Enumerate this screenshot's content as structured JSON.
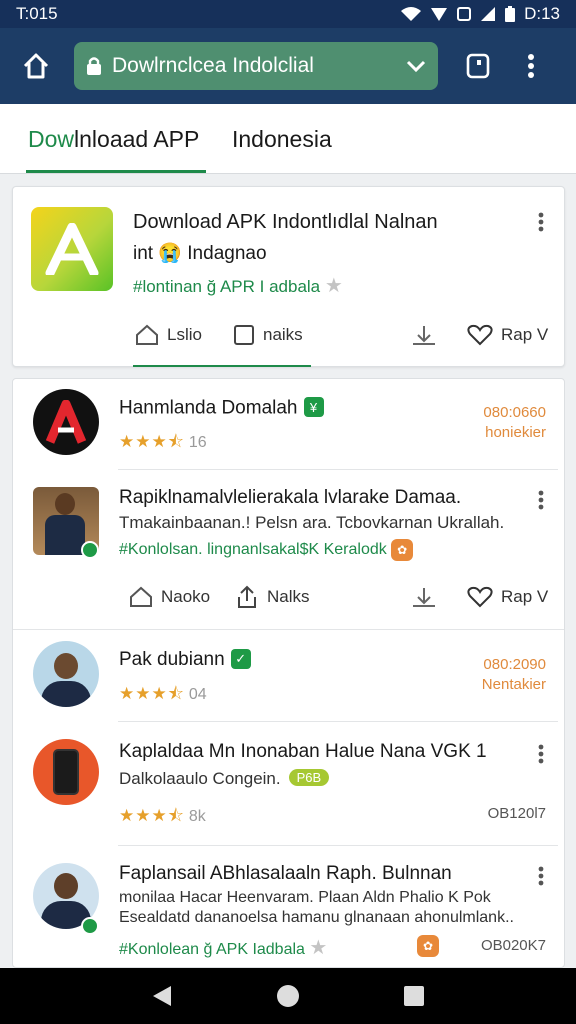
{
  "status": {
    "time": "T:015",
    "clock": "D:13"
  },
  "toolbar": {
    "url": "Dowlrnclcea Indolclial"
  },
  "tabs": [
    {
      "accent": "Dow",
      "rest": "lnloaad APP"
    },
    {
      "label": "Indonesia"
    }
  ],
  "featured": {
    "title": "Download APK Indontlıdlal Nalnan",
    "subtitle": "int 😭 Indagnao",
    "tag": "#lontinan ğ APR I adbala",
    "actions": {
      "a1": "Lslio",
      "a2": "naiks",
      "a3": "Rap V"
    }
  },
  "items": [
    {
      "title": "Hanmlanda Domalah",
      "rating_value": "16",
      "stars": 3.5,
      "price_top": "080:0660",
      "price_bottom": "honiekier"
    },
    {
      "title": "Rapiklnamalvlelierakala lvlarake Damaa.",
      "line": "Tmakainbaanan.! Pelsn ara. Tcbovkarnan Ukrallah.",
      "tag": "#Konlolsan. lingnanlsakal$K Keralodk",
      "actions": {
        "a1": "Naoko",
        "a2": "Nalks",
        "a3": "Rap V"
      }
    },
    {
      "title": "Pak dubiann",
      "rating_value": "04",
      "stars": 3.5,
      "price_top": "080:2090",
      "price_bottom": "Nentakier"
    },
    {
      "title": "Kaplaldaa Mn Inonaban Halue Nana VGK 1",
      "line": "Dalkolaaulo Congein.",
      "pill": "P6B",
      "rating_value": "8k",
      "stars": 3.5,
      "meta": "OB120l7"
    },
    {
      "title": "Faplansail ABhlasalaaln Raph. Bulnnan",
      "line1": "monilaa Hacar Heenvaram. Plaan Aldn Phalio K Pok",
      "line2": "Esealdatd dananoelsa hamanu glnanaan ahonulmlank..",
      "tag": "#Konlolean ğ APK Iadbala",
      "meta": "OB020K7"
    }
  ]
}
